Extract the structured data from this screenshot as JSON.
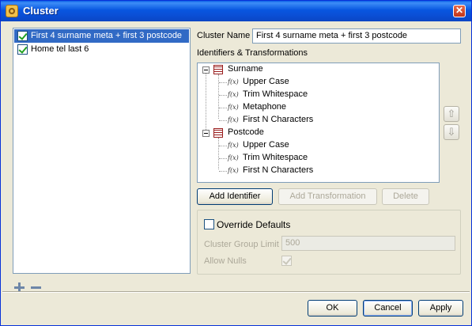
{
  "window": {
    "title": "Cluster",
    "close_symbol": "✕"
  },
  "clusters": [
    {
      "label": "First 4 surname meta + first 3 postcode",
      "checked": true,
      "selected": true
    },
    {
      "label": "Home tel last 6",
      "checked": true,
      "selected": false
    }
  ],
  "form": {
    "cluster_name_label": "Cluster Name",
    "cluster_name_value": "First 4 surname meta + first 3 postcode",
    "identifiers_label": "Identifiers & Transformations"
  },
  "tree": {
    "identifiers": [
      {
        "name": "Surname",
        "transformations": [
          "Upper Case",
          "Trim Whitespace",
          "Metaphone",
          "First N Characters"
        ]
      },
      {
        "name": "Postcode",
        "transformations": [
          "Upper Case",
          "Trim Whitespace",
          "First N Characters"
        ]
      }
    ],
    "fx_symbol": "f(x)"
  },
  "tree_buttons": {
    "add_identifier": "Add Identifier",
    "add_transformation": "Add Transformation",
    "delete": "Delete"
  },
  "defaults": {
    "override_label": "Override Defaults",
    "override_checked": false,
    "group_limit_label": "Cluster Group Limit",
    "group_limit_value": "500",
    "allow_nulls_label": "Allow Nulls",
    "allow_nulls_checked": true
  },
  "dialog_buttons": {
    "ok": "OK",
    "cancel": "Cancel",
    "apply": "Apply"
  },
  "icons": {
    "move_up": "⇧",
    "move_down": "⇩"
  }
}
